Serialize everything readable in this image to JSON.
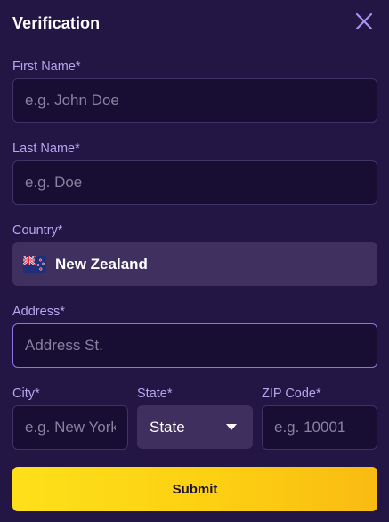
{
  "modal": {
    "title": "Verification",
    "close_icon": "close-icon"
  },
  "form": {
    "first_name": {
      "label": "First Name*",
      "placeholder": "e.g. John Doe",
      "value": ""
    },
    "last_name": {
      "label": "Last Name*",
      "placeholder": "e.g. Doe",
      "value": ""
    },
    "country": {
      "label": "Country*",
      "selected": "New Zealand",
      "flag_icon": "new-zealand-flag-icon"
    },
    "address": {
      "label": "Address*",
      "placeholder": "Address St.",
      "value": ""
    },
    "city": {
      "label": "City*",
      "placeholder": "e.g. New York",
      "value": ""
    },
    "state": {
      "label": "State*",
      "selected": "State",
      "chevron_icon": "chevron-down-icon"
    },
    "zip": {
      "label": "ZIP Code*",
      "placeholder": "e.g. 10001",
      "value": ""
    },
    "submit_label": "Submit"
  },
  "colors": {
    "background": "#231544",
    "input_background": "#180d33",
    "label": "#b7a6ee",
    "accent_border": "#8e76e6",
    "submit_yellow": "#fdd012"
  }
}
